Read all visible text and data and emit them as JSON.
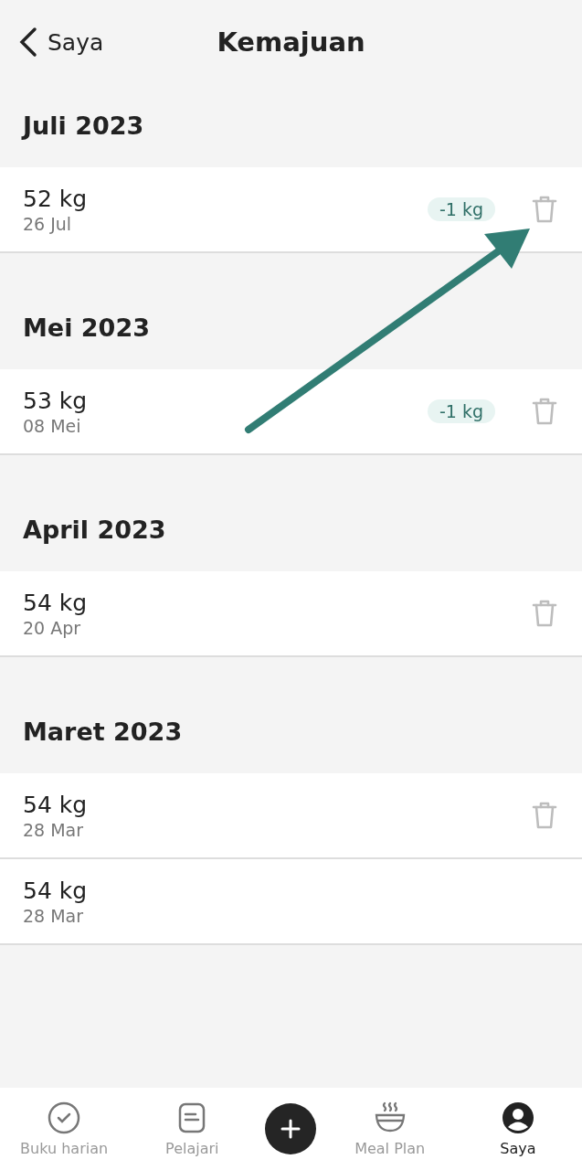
{
  "header": {
    "back_label": "Saya",
    "title": "Kemajuan"
  },
  "sections": [
    {
      "title": "Juli 2023",
      "entries": [
        {
          "weight": "52 kg",
          "date": "26 Jul",
          "change": "-1 kg",
          "deletable": true
        }
      ]
    },
    {
      "title": "Mei 2023",
      "entries": [
        {
          "weight": "53 kg",
          "date": "08 Mei",
          "change": "-1 kg",
          "deletable": true
        }
      ]
    },
    {
      "title": "April 2023",
      "entries": [
        {
          "weight": "54 kg",
          "date": "20 Apr",
          "deletable": true
        }
      ]
    },
    {
      "title": "Maret 2023",
      "entries": [
        {
          "weight": "54 kg",
          "date": "28 Mar",
          "deletable": true
        },
        {
          "weight": "54 kg",
          "date": "28 Mar",
          "deletable": false
        }
      ]
    }
  ],
  "nav": [
    {
      "kind": "check",
      "label": "Buku harian",
      "selected": false
    },
    {
      "kind": "note",
      "label": "Pelajari",
      "selected": false
    },
    {
      "kind": "add"
    },
    {
      "kind": "bowl",
      "label": "Meal Plan",
      "selected": false
    },
    {
      "kind": "person",
      "label": "Saya",
      "selected": true
    }
  ]
}
